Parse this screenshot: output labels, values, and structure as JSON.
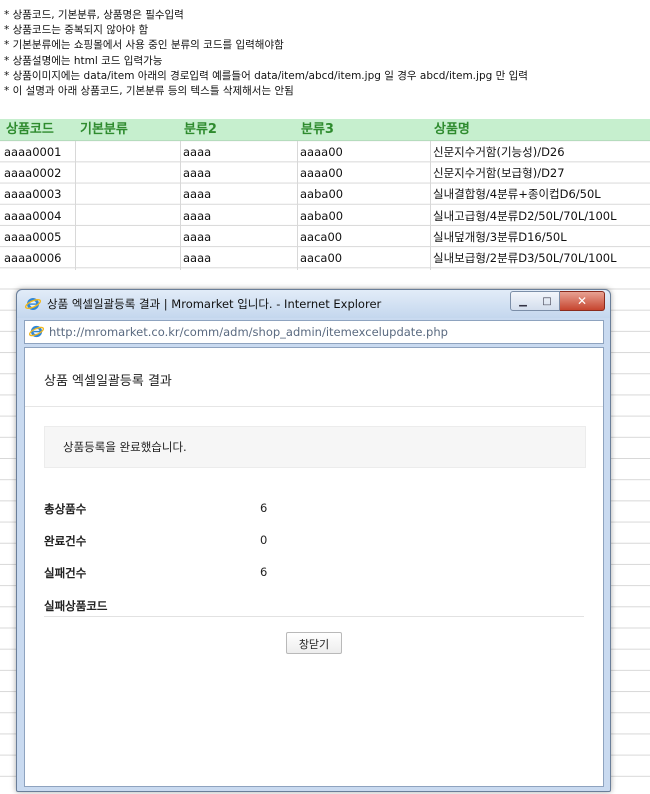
{
  "notes": [
    "* 상품코드, 기본분류, 상품명은 필수입력",
    "* 상품코드는 중복되지 않아야 함",
    "* 기본분류에는 쇼핑몰에서 사용 중인 분류의 코드를 입력해야함",
    "* 상품설명에는 html 코드 입력가능",
    "* 상품이미지에는 data/item 아래의 경로입력 예를들어 data/item/abcd/item.jpg 일 경우 abcd/item.jpg 만 입력",
    "* 이 설명과 아래 상품코드, 기본분류 등의 텍스틀 삭제해서는 안됨"
  ],
  "sheet": {
    "headers": [
      "상품코드",
      "기본분류",
      "분류2",
      "분류3",
      "상품명"
    ],
    "rows": [
      [
        "aaaa0001",
        "",
        "aaaa",
        "aaaa00",
        "신문지수거함(기능성)/D26"
      ],
      [
        "aaaa0002",
        "",
        "aaaa",
        "aaaa00",
        "신문지수거함(보급형)/D27"
      ],
      [
        "aaaa0003",
        "",
        "aaaa",
        "aaba00",
        "실내결합형/4분류+종이컵D6/50L"
      ],
      [
        "aaaa0004",
        "",
        "aaaa",
        "aaba00",
        "실내고급형/4분류D2/50L/70L/100L"
      ],
      [
        "aaaa0005",
        "",
        "aaaa",
        "aaca00",
        "실내덮개형/3분류D16/50L"
      ],
      [
        "aaaa0006",
        "",
        "aaaa",
        "aaca00",
        "실내보급형/2분류D3/50L/70L/100L"
      ]
    ]
  },
  "window": {
    "title": "상품 엑셀일괄등록 결과 | Mromarket 입니다. - Internet Explorer",
    "url": "http://mromarket.co.kr/comm/adm/shop_admin/itemexcelupdate.php",
    "minimize_glyph": "▁",
    "maximize_glyph": "□",
    "close_glyph": "✕"
  },
  "page": {
    "title": "상품 엑셀일괄등록 결과",
    "message": "상품등록을 완료했습니다.",
    "stats": [
      {
        "label": "총상품수",
        "value": "6"
      },
      {
        "label": "완료건수",
        "value": "0"
      },
      {
        "label": "실패건수",
        "value": "6"
      },
      {
        "label": "실패상품코드",
        "value": ""
      }
    ],
    "close_button": "창닫기"
  },
  "colors": {
    "header_bg": "#c6efce",
    "header_text": "#2e8b2e",
    "window_frame": "#c9daf0",
    "close_red": "#c6452f"
  }
}
